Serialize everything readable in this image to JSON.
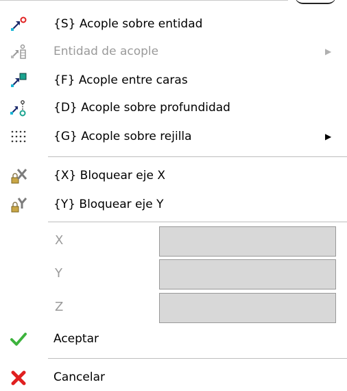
{
  "menu": {
    "items": [
      {
        "key": "snap_entity",
        "label": "{S} Acople sobre entidad",
        "disabled": false,
        "submenu": false,
        "icon": "snap-entity-icon"
      },
      {
        "key": "snap_entity_type",
        "label": "Entidad de acople",
        "disabled": true,
        "submenu": true,
        "icon": "snap-entity-type-icon"
      },
      {
        "key": "snap_faces",
        "label": "{F} Acople entre caras",
        "disabled": false,
        "submenu": false,
        "icon": "snap-faces-icon"
      },
      {
        "key": "snap_depth",
        "label": "{D} Acople sobre profundidad",
        "disabled": false,
        "submenu": false,
        "icon": "snap-depth-icon"
      },
      {
        "key": "snap_grid",
        "label": "{G} Acople sobre rejilla",
        "disabled": false,
        "submenu": true,
        "icon": "snap-grid-icon"
      },
      {
        "key": "lock_x",
        "label": "{X} Bloquear eje X",
        "disabled": false,
        "submenu": false,
        "icon": "lock-x-icon"
      },
      {
        "key": "lock_y",
        "label": "{Y} Bloquear eje Y",
        "disabled": false,
        "submenu": false,
        "icon": "lock-y-icon"
      },
      {
        "key": "accept",
        "label": "Aceptar",
        "disabled": false,
        "submenu": false,
        "icon": "checkmark-icon"
      },
      {
        "key": "cancel",
        "label": "Cancelar",
        "disabled": false,
        "submenu": false,
        "icon": "cancel-x-icon"
      }
    ],
    "coords": [
      {
        "label": "X",
        "value": ""
      },
      {
        "label": "Y",
        "value": ""
      },
      {
        "label": "Z",
        "value": ""
      }
    ]
  },
  "colors": {
    "disabled_text": "#9a9a9a",
    "field_bg": "#d8d8d8",
    "check_green": "#3db33d",
    "cancel_red": "#e02020",
    "cyan": "#19b6d6",
    "navy": "#1b2a6b",
    "teal": "#1aa38f"
  }
}
